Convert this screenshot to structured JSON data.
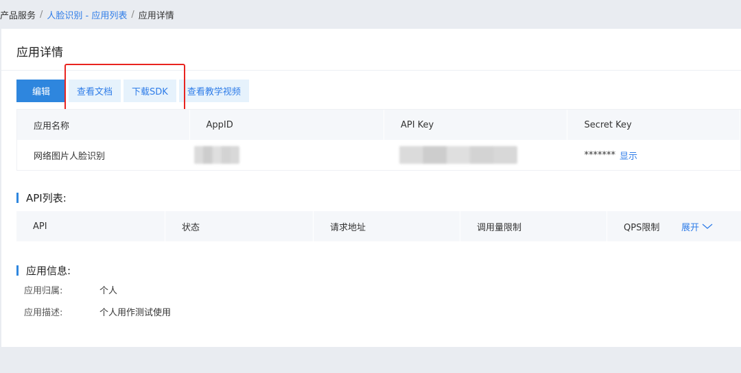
{
  "breadcrumb": {
    "root": "产品服务",
    "separator": "/",
    "parent": "人脸识别 - 应用列表",
    "current": "应用详情"
  },
  "page": {
    "title": "应用详情"
  },
  "toolbar": {
    "edit": "编辑",
    "docs": "查看文档",
    "sdk": "下载SDK",
    "video": "查看教学视频"
  },
  "keys_table": {
    "headers": [
      "应用名称",
      "AppID",
      "API Key",
      "Secret Key"
    ],
    "row": {
      "app_name": "网络图片人脸识别",
      "secret_masked": "*******",
      "show_label": "显示"
    }
  },
  "api_section": {
    "title": "API列表:",
    "headers": [
      "API",
      "状态",
      "请求地址",
      "调用量限制",
      "QPS限制"
    ],
    "expand_label": "展开"
  },
  "info_section": {
    "title": "应用信息:",
    "owner_label": "应用归属:",
    "owner_value": "个人",
    "desc_label": "应用描述:",
    "desc_value": "个人用作测试使用"
  },
  "colors": {
    "accent": "#2e86de",
    "link": "#2e7ce8",
    "highlight": "#e8231f",
    "background": "#e9ecf1"
  }
}
